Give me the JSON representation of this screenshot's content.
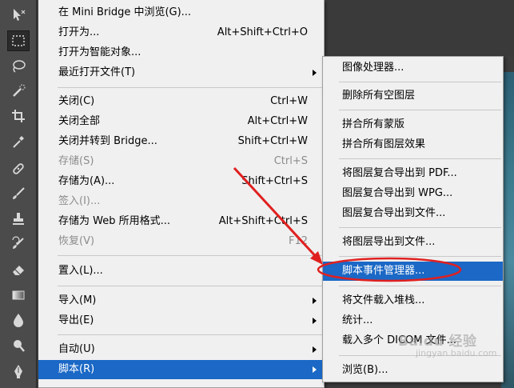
{
  "main_menu": {
    "items": [
      {
        "label": "在 Mini Bridge 中浏览(G)...",
        "shortcut": ""
      },
      {
        "label": "打开为...",
        "shortcut": "Alt+Shift+Ctrl+O"
      },
      {
        "label": "打开为智能对象...",
        "shortcut": ""
      },
      {
        "label": "最近打开文件(T)",
        "shortcut": ""
      },
      {
        "label": "关闭(C)",
        "shortcut": "Ctrl+W"
      },
      {
        "label": "关闭全部",
        "shortcut": "Alt+Ctrl+W"
      },
      {
        "label": "关闭并转到 Bridge...",
        "shortcut": "Shift+Ctrl+W"
      },
      {
        "label": "存储(S)",
        "shortcut": "Ctrl+S"
      },
      {
        "label": "存储为(A)...",
        "shortcut": "Shift+Ctrl+S"
      },
      {
        "label": "签入(I)...",
        "shortcut": ""
      },
      {
        "label": "存储为 Web 所用格式...",
        "shortcut": "Alt+Shift+Ctrl+S"
      },
      {
        "label": "恢复(V)",
        "shortcut": "F12"
      },
      {
        "label": "置入(L)...",
        "shortcut": ""
      },
      {
        "label": "导入(M)",
        "shortcut": ""
      },
      {
        "label": "导出(E)",
        "shortcut": ""
      },
      {
        "label": "自动(U)",
        "shortcut": ""
      },
      {
        "label": "脚本(R)",
        "shortcut": ""
      }
    ]
  },
  "scripts_submenu": {
    "items": [
      {
        "label": "图像处理器..."
      },
      {
        "label": "删除所有空图层"
      },
      {
        "label": "拼合所有蒙版"
      },
      {
        "label": "拼合所有图层效果"
      },
      {
        "label": "将图层复合导出到 PDF..."
      },
      {
        "label": "图层复合导出到 WPG..."
      },
      {
        "label": "图层复合导出到文件..."
      },
      {
        "label": "将图层导出到文件..."
      },
      {
        "label": "脚本事件管理器..."
      },
      {
        "label": "将文件载入堆栈..."
      },
      {
        "label": "统计..."
      },
      {
        "label": "载入多个 DICOM 文件..."
      },
      {
        "label": "浏览(B)..."
      }
    ]
  },
  "toolbar": {
    "tools": [
      "move-tool-icon",
      "marquee-tool-icon",
      "lasso-tool-icon",
      "quick-select-tool-icon",
      "crop-tool-icon",
      "eyedropper-tool-icon",
      "healing-brush-tool-icon",
      "brush-tool-icon",
      "clone-stamp-tool-icon",
      "history-brush-tool-icon",
      "eraser-tool-icon",
      "gradient-tool-icon",
      "blur-tool-icon",
      "dodge-tool-icon",
      "pen-tool-icon"
    ]
  },
  "annotation": {
    "color": "#e02020"
  },
  "watermark": {
    "text": "Baidu 经验",
    "sub": "jingyan.baidu.com"
  }
}
